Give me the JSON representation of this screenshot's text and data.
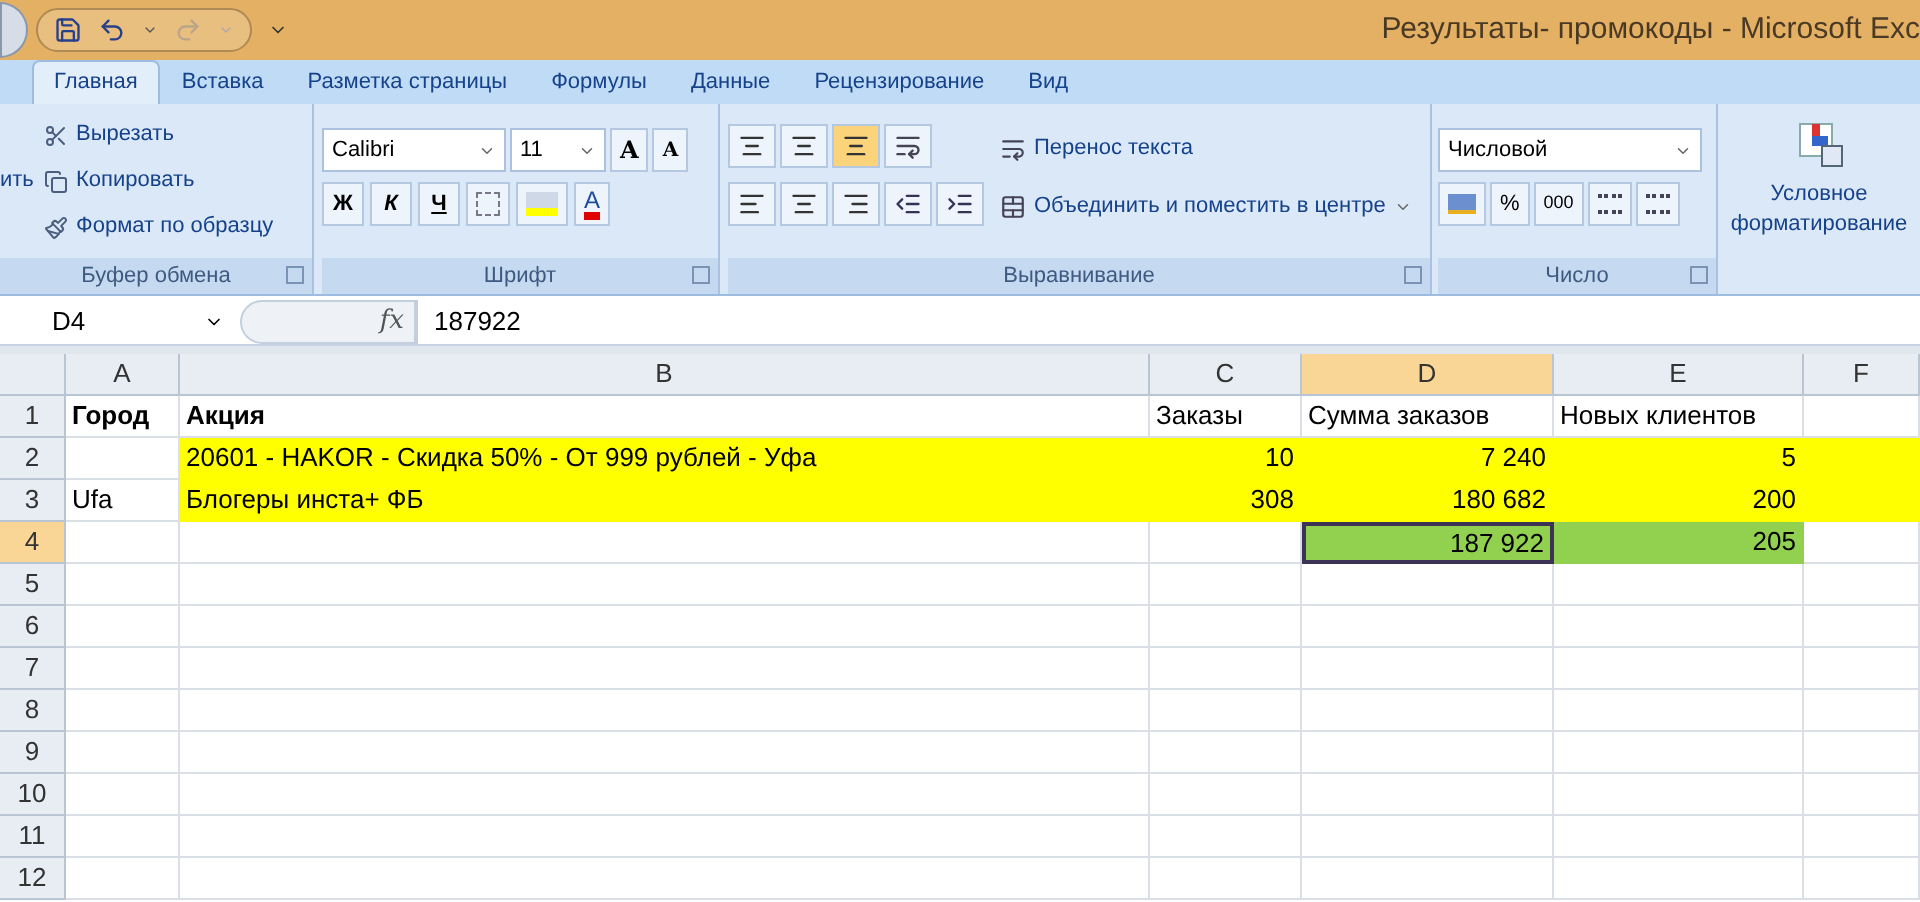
{
  "window": {
    "title": "Результаты- промокоды - Microsoft Exc"
  },
  "tabs": [
    {
      "label": "Главная",
      "selected": true
    },
    {
      "label": "Вставка",
      "selected": false
    },
    {
      "label": "Разметка страницы",
      "selected": false
    },
    {
      "label": "Формулы",
      "selected": false
    },
    {
      "label": "Данные",
      "selected": false
    },
    {
      "label": "Рецензирование",
      "selected": false
    },
    {
      "label": "Вид",
      "selected": false
    }
  ],
  "ribbon": {
    "clipboard": {
      "paste_label": "ить",
      "actions": [
        "Вырезать",
        "Копировать",
        "Формат по образцу"
      ],
      "group_label": "Буфер обмена"
    },
    "font": {
      "font_name": "Calibri",
      "font_size": "11",
      "grow_label": "A",
      "shrink_label": "A",
      "styles": [
        "Ж",
        "К",
        "Ч"
      ],
      "color_label": "A",
      "group_label": "Шрифт"
    },
    "alignment": {
      "wrap_text": "Перенос текста",
      "merge_center": "Объединить и поместить в центре",
      "group_label": "Выравнивание"
    },
    "number": {
      "format": "Числовой",
      "percent": "%",
      "thousands": "000",
      "group_label": "Число"
    },
    "styles": {
      "conditional_formatting": "Условное форматирование"
    }
  },
  "formula_bar": {
    "name_box": "D4",
    "function_label": "fx",
    "value": "187922"
  },
  "sheet": {
    "columns": [
      {
        "label": "A",
        "selected": false
      },
      {
        "label": "B",
        "selected": false
      },
      {
        "label": "C",
        "selected": false
      },
      {
        "label": "D",
        "selected": true
      },
      {
        "label": "E",
        "selected": false
      },
      {
        "label": "F",
        "selected": false
      }
    ],
    "rows": [
      {
        "number": "1",
        "selected": false,
        "cells": [
          {
            "text": "Город",
            "kind": "heading"
          },
          {
            "text": "Акция",
            "kind": "heading"
          },
          {
            "text": "Заказы",
            "kind": "text"
          },
          {
            "text": "Сумма заказов",
            "kind": "text"
          },
          {
            "text": "Новых клиентов",
            "kind": "text"
          },
          {}
        ]
      },
      {
        "number": "2",
        "selected": false,
        "cells": [
          {},
          {
            "text": "20601 - HAKOR - Скидка 50% - От 999 рублей - Уфа",
            "kind": "text",
            "color": "#ffff00"
          },
          {
            "text": "10",
            "kind": "number",
            "color": "#ffff00"
          },
          {
            "text": "7 240",
            "kind": "number",
            "color": "#ffff00"
          },
          {
            "text": "5",
            "kind": "number",
            "color": "#ffff00"
          },
          {
            "color": "#ffff00"
          }
        ]
      },
      {
        "number": "3",
        "selected": false,
        "cells": [
          {
            "text": "Ufa",
            "kind": "text"
          },
          {
            "text": "Блогеры инста+ ФБ",
            "kind": "text",
            "color": "#ffff00"
          },
          {
            "text": "308",
            "kind": "number",
            "color": "#ffff00"
          },
          {
            "text": "180 682",
            "kind": "number",
            "color": "#ffff00"
          },
          {
            "text": "200",
            "kind": "number",
            "color": "#ffff00"
          },
          {
            "color": "#ffff00"
          }
        ]
      },
      {
        "number": "4",
        "selected": true,
        "cells": [
          {},
          {},
          {},
          {
            "text": "187 922",
            "kind": "number",
            "color": "#92d050",
            "selected": true
          },
          {
            "text": "205",
            "kind": "number",
            "color": "#92d050"
          },
          {}
        ]
      },
      {
        "number": "5",
        "selected": false,
        "cells": [
          {},
          {},
          {},
          {},
          {},
          {}
        ]
      },
      {
        "number": "6",
        "selected": false,
        "cells": [
          {},
          {},
          {},
          {},
          {},
          {}
        ]
      },
      {
        "number": "7",
        "selected": false,
        "cells": [
          {},
          {},
          {},
          {},
          {},
          {}
        ]
      },
      {
        "number": "8",
        "selected": false,
        "cells": [
          {},
          {},
          {},
          {},
          {},
          {}
        ]
      },
      {
        "number": "9",
        "selected": false,
        "cells": [
          {},
          {},
          {},
          {},
          {},
          {}
        ]
      },
      {
        "number": "10",
        "selected": false,
        "cells": [
          {},
          {},
          {},
          {},
          {},
          {}
        ]
      },
      {
        "number": "11",
        "selected": false,
        "cells": [
          {},
          {},
          {},
          {},
          {},
          {}
        ]
      },
      {
        "number": "12",
        "selected": false,
        "cells": [
          {},
          {},
          {},
          {},
          {},
          {}
        ]
      }
    ]
  }
}
